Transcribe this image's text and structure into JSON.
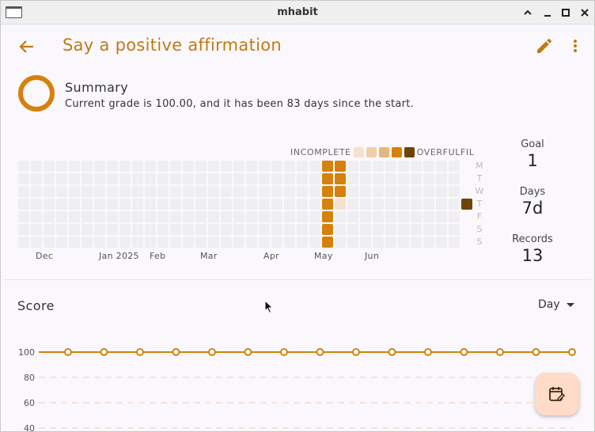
{
  "window": {
    "title": "mhabit"
  },
  "appbar": {
    "title": "Say a positive affirmation"
  },
  "summary": {
    "title": "Summary",
    "description": "Current grade is 100.00, and it has been 83 days since the start."
  },
  "legend": {
    "left_label": "INCOMPLETE",
    "right_label": "OVERFULFIL",
    "swatch_colors": [
      "#f4e2cd",
      "#efcfaa",
      "#e6b67f",
      "#d5810b",
      "#6e4406"
    ]
  },
  "heatmap": {
    "day_labels": [
      "M",
      "T",
      "W",
      "T",
      "F",
      "S",
      "S"
    ],
    "months": [
      {
        "label": "Dec",
        "col": 2
      },
      {
        "label": "Jan 2025",
        "col": 7
      },
      {
        "label": "Feb",
        "col": 11
      },
      {
        "label": "Mar",
        "col": 15
      },
      {
        "label": "Apr",
        "col": 20
      },
      {
        "label": "May",
        "col": 24
      },
      {
        "label": "Jun",
        "col": 28
      }
    ],
    "columns": 35,
    "filled": [
      {
        "col": 24,
        "row": 0,
        "level": 3
      },
      {
        "col": 24,
        "row": 1,
        "level": 3
      },
      {
        "col": 24,
        "row": 2,
        "level": 3
      },
      {
        "col": 24,
        "row": 3,
        "level": 3
      },
      {
        "col": 24,
        "row": 4,
        "level": 3
      },
      {
        "col": 24,
        "row": 5,
        "level": 3
      },
      {
        "col": 24,
        "row": 6,
        "level": 3
      },
      {
        "col": 25,
        "row": 0,
        "level": 3
      },
      {
        "col": 25,
        "row": 1,
        "level": 3
      },
      {
        "col": 25,
        "row": 2,
        "level": 3
      },
      {
        "col": 25,
        "row": 3,
        "level": 0
      },
      {
        "col": 35,
        "row": 3,
        "level": 4
      }
    ]
  },
  "stats": {
    "goal_label": "Goal",
    "goal_value": "1",
    "days_label": "Days",
    "days_value": "7d",
    "records_label": "Records",
    "records_value": "13"
  },
  "score": {
    "title": "Score",
    "period": "Day"
  },
  "chart_data": {
    "type": "line",
    "y_ticks": [
      "100",
      "80",
      "60",
      "40"
    ],
    "series": [
      {
        "values": [
          100,
          100,
          100,
          100,
          100,
          100,
          100,
          100,
          100,
          100,
          100,
          100,
          100,
          100,
          100
        ]
      }
    ],
    "color": "#d5810b"
  }
}
